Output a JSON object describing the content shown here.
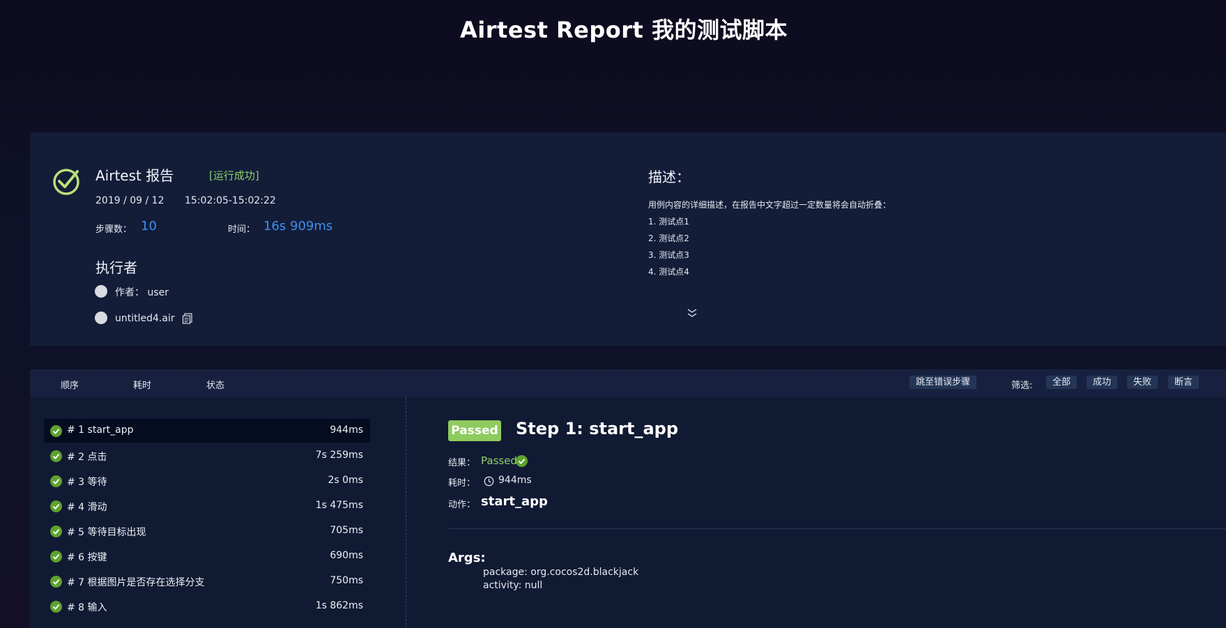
{
  "page_title": "Airtest Report 我的测试脚本",
  "summary": {
    "report_title": "Airtest 报告",
    "run_status": "[运行成功]",
    "date": "2019 / 09 / 12",
    "time_range": "15:02:05-15:02:22",
    "steps_label": "步骤数：",
    "steps_value": "10",
    "duration_label": "时间：",
    "duration_value": "16s 909ms",
    "executor_title": "执行者",
    "author": "作者： user",
    "script_name": "untitled4.air",
    "description_title": "描述：",
    "description_lines": [
      "用例内容的详细描述，在报告中文字超过一定数量将会自动折叠：",
      "1. 测试点1",
      "2. 测试点2",
      "3. 测试点3",
      "4. 测试点4"
    ]
  },
  "toolbar": {
    "sort_order": "顺序",
    "sort_time": "耗时",
    "sort_status": "状态",
    "jump_error": "跳至错误步骤",
    "filter_label": "筛选:",
    "filter_all": "全部",
    "filter_success": "成功",
    "filter_fail": "失败",
    "filter_assert": "断言"
  },
  "steps": [
    {
      "name": "# 1  start_app",
      "duration": "944ms"
    },
    {
      "name": "# 2  点击",
      "duration": "7s 259ms"
    },
    {
      "name": "# 3  等待",
      "duration": "2s 0ms"
    },
    {
      "name": "# 4  滑动",
      "duration": "1s 475ms"
    },
    {
      "name": "# 5  等待目标出现",
      "duration": "705ms"
    },
    {
      "name": "# 6  按键",
      "duration": "690ms"
    },
    {
      "name": "# 7  根据图片是否存在选择分支",
      "duration": "750ms"
    },
    {
      "name": "# 8  输入",
      "duration": "1s 862ms"
    }
  ],
  "detail": {
    "badge": "Passed",
    "title": "Step 1: start_app",
    "result_label": "结果：",
    "result_value": "Passed",
    "duration_label": "耗时：",
    "duration_value": "944ms",
    "action_label": "动作：",
    "action_value": "start_app",
    "args_title": "Args:",
    "args": [
      "package: org.cocos2d.blackjack",
      "activity: null"
    ]
  },
  "colors": {
    "accent_blue": "#3d8ff0",
    "success_green": "#8fd16a",
    "panel_bg": "#131d38"
  }
}
